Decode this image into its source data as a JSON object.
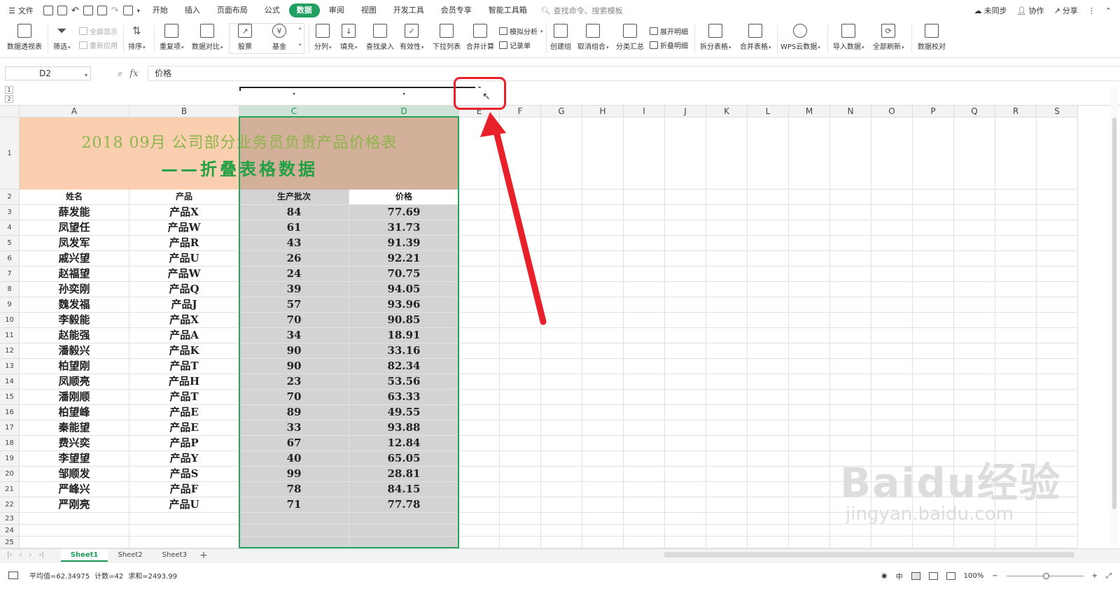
{
  "menu": {
    "file": "文件",
    "tabs": [
      "开始",
      "插入",
      "页面布局",
      "公式",
      "数据",
      "审阅",
      "视图",
      "开发工具",
      "会员专享",
      "智能工具箱"
    ],
    "active_tab": "数据",
    "search": "查找命令、搜索模板",
    "sync": "未同步",
    "collab": "协作",
    "share": "分享"
  },
  "ribbon": {
    "pivot": "数据透视表",
    "filter": "筛选",
    "show_all": "全部显示",
    "reapply": "重新应用",
    "sort": "排序",
    "dup": "重复项",
    "compare": "数据对比",
    "stock": "股票",
    "fund": "基金",
    "split": "分列",
    "fill": "填充",
    "lookup": "查找录入",
    "valid": "有效性",
    "dropdown": "下拉列表",
    "consolidate": "合并计算",
    "simulate": "模拟分析",
    "record": "记录单",
    "group": "创建组",
    "ungroup": "取消组合",
    "subtotal": "分类汇总",
    "expand": "展开明细",
    "collapse": "折叠明细",
    "split_table": "拆分表格",
    "merge_table": "合并表格",
    "cloud": "WPS云数据",
    "import": "导入数据",
    "refresh": "全部刷新",
    "verify": "数据校对"
  },
  "formula": {
    "cell": "D2",
    "fx": "fx",
    "value": "价格"
  },
  "outline": {
    "levels": [
      "1",
      "2"
    ],
    "collapse_btn": "-"
  },
  "columns": [
    "A",
    "B",
    "C",
    "D",
    "E",
    "F",
    "G",
    "H",
    "I",
    "J",
    "K",
    "L",
    "M",
    "N",
    "O",
    "P",
    "Q",
    "R",
    "S"
  ],
  "rows": [
    "1",
    "2",
    "3",
    "4",
    "5",
    "6",
    "7",
    "8",
    "9",
    "10",
    "11",
    "12",
    "13",
    "14",
    "15",
    "16",
    "17",
    "18",
    "19",
    "20",
    "21",
    "22",
    "23",
    "24",
    "25"
  ],
  "title_line1": "2018 09月 公司部分业务员负责产品价格表",
  "title_line2": "——折叠表格数据",
  "headers": [
    "姓名",
    "产品",
    "生产批次",
    "价格"
  ],
  "data": [
    [
      "薛发能",
      "产品X",
      "84",
      "77.69"
    ],
    [
      "凤望任",
      "产品W",
      "61",
      "31.73"
    ],
    [
      "凤发军",
      "产品R",
      "43",
      "91.39"
    ],
    [
      "戚兴望",
      "产品U",
      "26",
      "92.21"
    ],
    [
      "赵福望",
      "产品W",
      "24",
      "70.75"
    ],
    [
      "孙奕刚",
      "产品Q",
      "39",
      "94.05"
    ],
    [
      "魏发福",
      "产品J",
      "57",
      "93.96"
    ],
    [
      "李毅能",
      "产品X",
      "70",
      "90.85"
    ],
    [
      "赵能强",
      "产品A",
      "34",
      "18.91"
    ],
    [
      "潘毅兴",
      "产品K",
      "90",
      "33.16"
    ],
    [
      "柏望刚",
      "产品T",
      "90",
      "82.34"
    ],
    [
      "凤顺亮",
      "产品H",
      "23",
      "53.56"
    ],
    [
      "潘刚顺",
      "产品T",
      "70",
      "63.33"
    ],
    [
      "柏望峰",
      "产品E",
      "89",
      "49.55"
    ],
    [
      "秦能望",
      "产品E",
      "33",
      "93.88"
    ],
    [
      "费兴奕",
      "产品P",
      "67",
      "12.84"
    ],
    [
      "李望望",
      "产品Y",
      "40",
      "65.05"
    ],
    [
      "邹顺发",
      "产品S",
      "99",
      "28.81"
    ],
    [
      "严峰兴",
      "产品F",
      "78",
      "84.15"
    ],
    [
      "严刚亮",
      "产品U",
      "71",
      "77.78"
    ]
  ],
  "sheets": [
    "Sheet1",
    "Sheet2",
    "Sheet3"
  ],
  "status": {
    "avg": "平均值=62.34975",
    "count": "计数=42",
    "sum": "求和=2493.99",
    "zoom": "100%",
    "ime": "中"
  },
  "watermark": {
    "brand": "Bai",
    "mid": "du",
    "cn": "经验",
    "url": "jingyan.baidu.com"
  },
  "colors": {
    "accent": "#20a162",
    "title_bg_left": "#f9cfb0",
    "title_bg_right": "#d3b09a",
    "selection_gray": "#d3d3d3",
    "arrow": "#e8202a"
  }
}
